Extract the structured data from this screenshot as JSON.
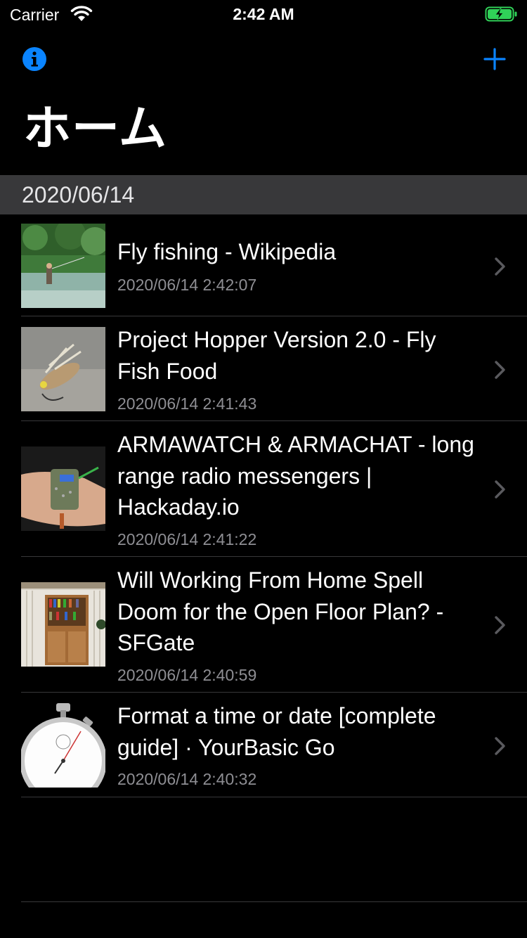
{
  "status_bar": {
    "carrier": "Carrier",
    "time": "2:42 AM"
  },
  "nav": {
    "title": "ホーム",
    "info_icon": "info-circle-icon",
    "add_icon": "plus-icon"
  },
  "colors": {
    "accent": "#0a84ff",
    "background": "#000000",
    "section_header": "#38383a",
    "secondary_text": "#8e8e93",
    "battery": "#30d158"
  },
  "section": {
    "header": "2020/06/14"
  },
  "items": [
    {
      "title": "Fly fishing - Wikipedia",
      "date": "2020/06/14 2:42:07",
      "thumbnail": "fly-fishing-photo"
    },
    {
      "title": "Project Hopper Version 2.0 - Fly Fish Food",
      "date": "2020/06/14 2:41:43",
      "thumbnail": "fly-lure-photo"
    },
    {
      "title": "ARMAWATCH & ARMACHAT - long range radio messengers | Hackaday.io",
      "date": "2020/06/14 2:41:22",
      "thumbnail": "radio-device-photo"
    },
    {
      "title": "Will Working From Home Spell Doom for the Open Floor Plan? - SFGate",
      "date": "2020/06/14 2:40:59",
      "thumbnail": "bookshelf-room-photo"
    },
    {
      "title": "Format a time or date [complete guide] · YourBasic Go",
      "date": "2020/06/14 2:40:32",
      "thumbnail": "stopwatch-image"
    }
  ]
}
